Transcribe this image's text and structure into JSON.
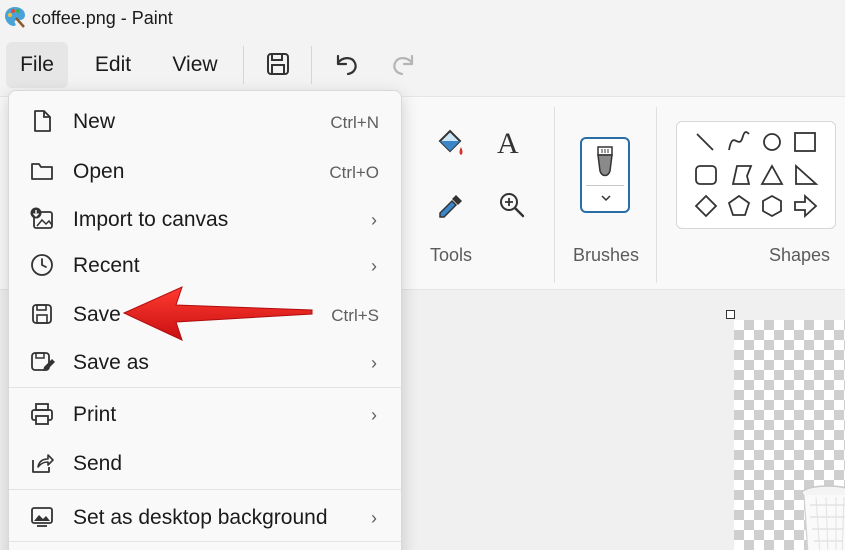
{
  "window": {
    "title": "coffee.png - Paint",
    "icon": "paint-palette-icon"
  },
  "menubar": {
    "items": [
      {
        "label": "File",
        "active": true
      },
      {
        "label": "Edit",
        "active": false
      },
      {
        "label": "View",
        "active": false
      }
    ],
    "quick_actions": [
      "save-icon",
      "undo-icon",
      "redo-icon"
    ]
  },
  "ribbon": {
    "groups": [
      {
        "label": "Tools",
        "icons": [
          "fill-bucket-icon",
          "text-icon",
          "color-picker-icon",
          "magnifier-icon"
        ]
      },
      {
        "label": "Brushes",
        "icons": [
          "brush-icon",
          "chevron-down-icon"
        ]
      },
      {
        "label": "Shapes",
        "icons": [
          "line-icon",
          "curve-icon",
          "oval-icon",
          "rectangle-icon",
          "rounded-rectangle-icon",
          "polygon-icon",
          "triangle-icon",
          "right-triangle-icon",
          "diamond-icon",
          "pentagon-icon",
          "hexagon-icon",
          "arrow-right-icon"
        ]
      }
    ]
  },
  "file_menu": {
    "items": [
      {
        "label": "New",
        "shortcut": "Ctrl+N",
        "icon": "new-file-icon"
      },
      {
        "label": "Open",
        "shortcut": "Ctrl+O",
        "icon": "folder-icon"
      },
      {
        "label": "Import to canvas",
        "icon": "import-image-icon",
        "submenu": true
      },
      {
        "label": "Recent",
        "icon": "clock-icon",
        "submenu": true
      },
      {
        "label": "Save",
        "shortcut": "Ctrl+S",
        "icon": "save-icon"
      },
      {
        "label": "Save as",
        "icon": "save-as-icon",
        "submenu": true
      },
      {
        "label": "Print",
        "icon": "printer-icon",
        "submenu": true
      },
      {
        "label": "Send",
        "icon": "share-icon"
      },
      {
        "label": "Set as desktop background",
        "icon": "desktop-background-icon",
        "submenu": true
      }
    ],
    "submenu_chevron": "›"
  },
  "annotation": {
    "type": "arrow",
    "points_to": "Save",
    "color": "#e8181a"
  },
  "colors": {
    "accent": "#2a6ea8",
    "arrow": "#e8181a"
  }
}
